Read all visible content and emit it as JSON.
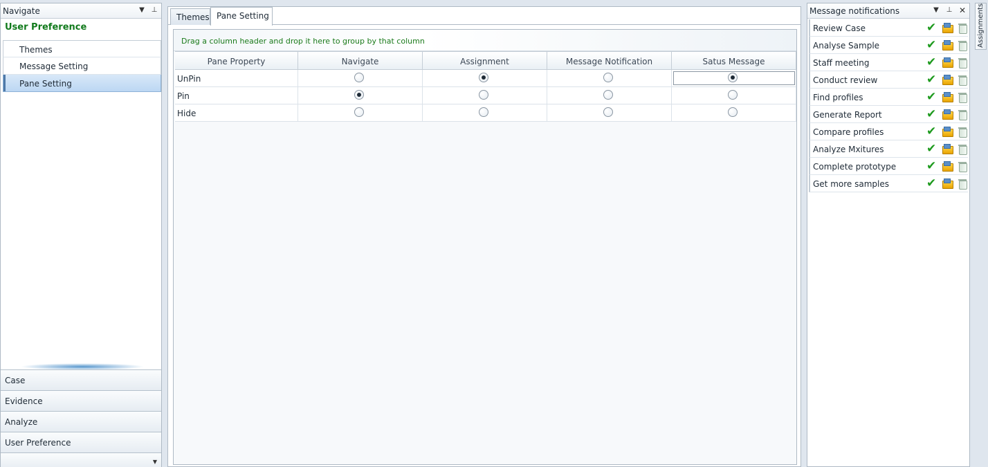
{
  "navigate_pane": {
    "title": "Navigate",
    "section_title": "User Preference",
    "items": [
      {
        "label": "Themes"
      },
      {
        "label": "Message Setting"
      },
      {
        "label": "Pane Setting"
      }
    ],
    "selected_item": "Pane Setting",
    "bottom_buttons": [
      {
        "label": "Case"
      },
      {
        "label": "Evidence"
      },
      {
        "label": "Analyze"
      },
      {
        "label": "User Preference"
      }
    ]
  },
  "document": {
    "tabs": [
      {
        "label": "Themes"
      },
      {
        "label": "Pane Setting"
      }
    ],
    "active_tab": "Pane Setting",
    "group_panel_text": "Drag a column header and drop it here to group by that column",
    "grid": {
      "columns": [
        "Pane Property",
        "Navigate",
        "Assignment",
        "Message Notification",
        "Satus Message"
      ],
      "rows": [
        {
          "label": "UnPin",
          "selected": [
            false,
            true,
            false,
            true
          ]
        },
        {
          "label": "Pin",
          "selected": [
            true,
            false,
            false,
            false
          ]
        },
        {
          "label": "Hide",
          "selected": [
            false,
            false,
            false,
            false
          ]
        }
      ]
    }
  },
  "message_pane": {
    "title": "Message notifications",
    "items": [
      {
        "text": "Review Case"
      },
      {
        "text": "Analyse Sample"
      },
      {
        "text": "Staff meeting"
      },
      {
        "text": "Conduct review"
      },
      {
        "text": "Find profiles"
      },
      {
        "text": "Generate Report"
      },
      {
        "text": "Compare profiles"
      },
      {
        "text": "Analyze Mxitures"
      },
      {
        "text": "Complete prototype"
      },
      {
        "text": "Get more samples"
      }
    ]
  },
  "side_tab": {
    "label": "Assignments"
  },
  "icons": {
    "dropdown": "chevron-down-icon",
    "pin": "pin-icon",
    "close": "close-icon",
    "check": "check-icon",
    "folder": "open-folder-icon",
    "bin": "recycle-bin-icon"
  },
  "colors": {
    "accent_green": "#117a1c",
    "selection_blue": "#bcd7f3",
    "check_green": "#1e9a1e"
  }
}
